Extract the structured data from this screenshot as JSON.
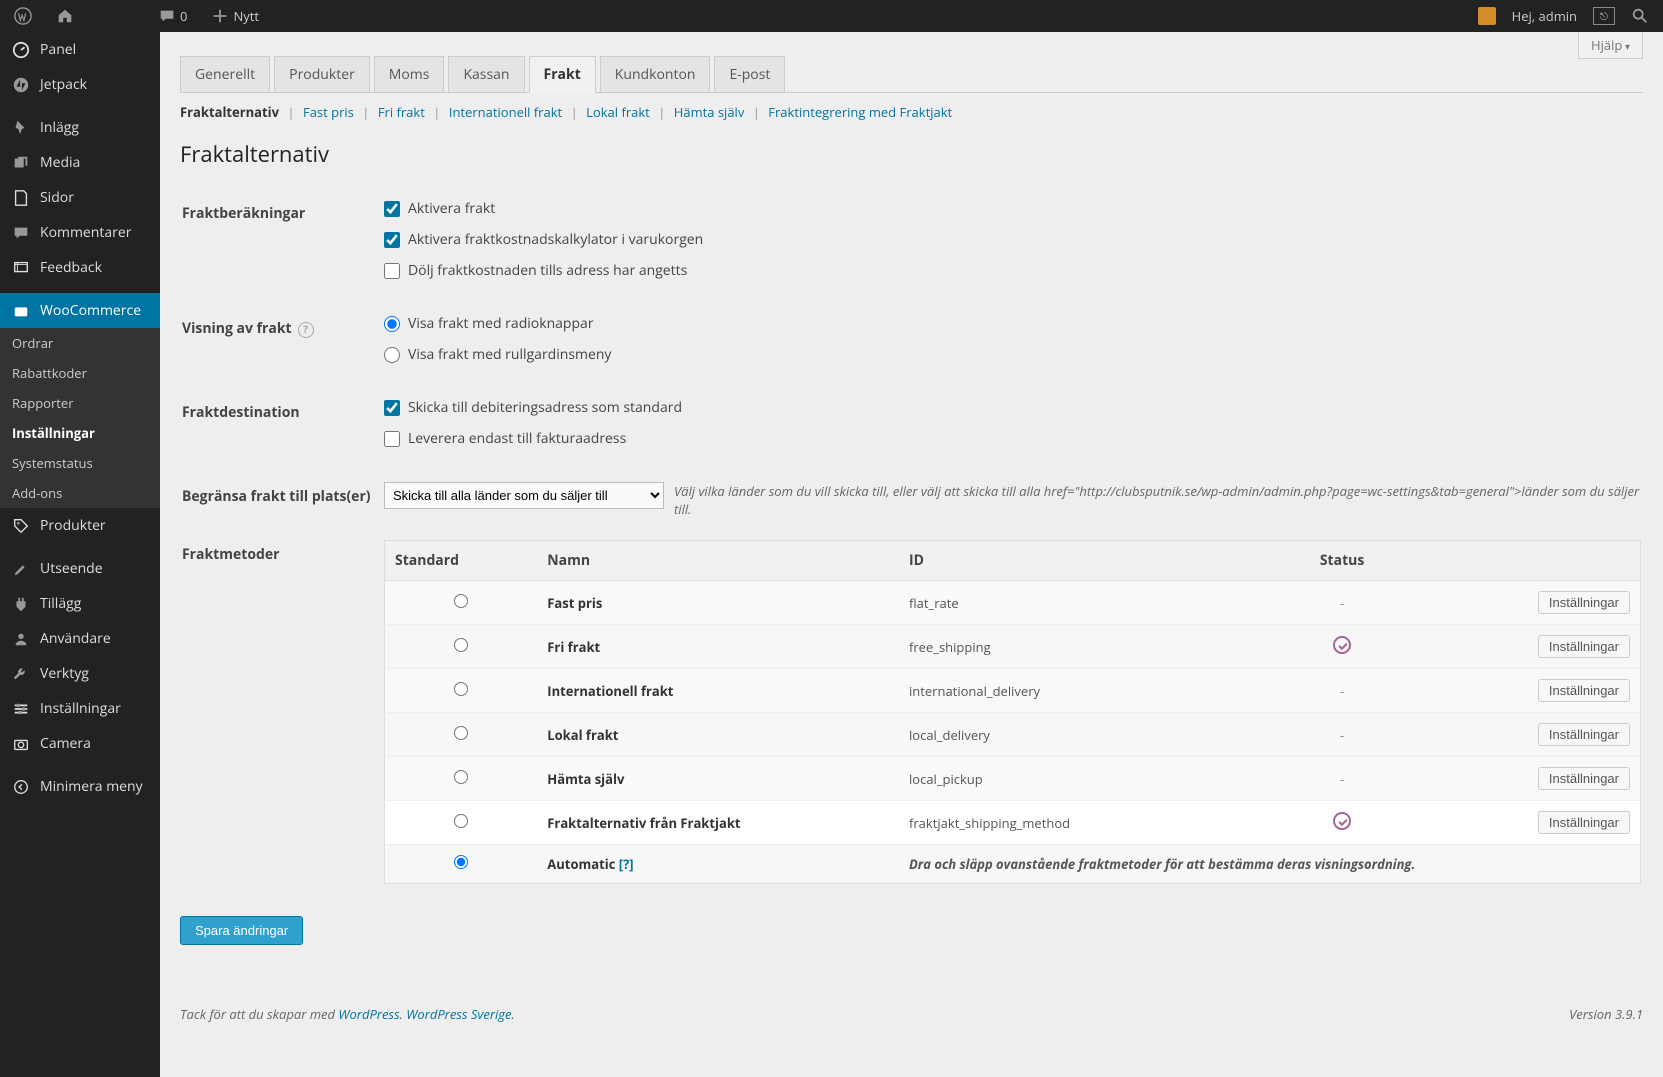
{
  "adminbar": {
    "comments": "0",
    "new_label": "Nytt",
    "greeting": "Hej, admin"
  },
  "sidebar": {
    "items": [
      {
        "label": "Panel",
        "icon": "dashboard"
      },
      {
        "label": "Jetpack",
        "icon": "jetpack"
      },
      {
        "label": "Inlägg",
        "icon": "pin"
      },
      {
        "label": "Media",
        "icon": "media"
      },
      {
        "label": "Sidor",
        "icon": "page"
      },
      {
        "label": "Kommentarer",
        "icon": "comment"
      },
      {
        "label": "Feedback",
        "icon": "feedback"
      },
      {
        "label": "WooCommerce",
        "icon": "cart"
      },
      {
        "label": "Produkter",
        "icon": "tag"
      },
      {
        "label": "Utseende",
        "icon": "brush"
      },
      {
        "label": "Tillägg",
        "icon": "plugin"
      },
      {
        "label": "Användare",
        "icon": "user"
      },
      {
        "label": "Verktyg",
        "icon": "wrench"
      },
      {
        "label": "Inställningar",
        "icon": "sliders"
      },
      {
        "label": "Camera",
        "icon": "camera"
      },
      {
        "label": "Minimera meny",
        "icon": "collapse"
      }
    ],
    "sub_wc": [
      "Ordrar",
      "Rabattkoder",
      "Rapporter",
      "Inställningar",
      "Systemstatus",
      "Add-ons"
    ]
  },
  "help": "Hjälp",
  "tabs": [
    "Generellt",
    "Produkter",
    "Moms",
    "Kassan",
    "Frakt",
    "Kundkonton",
    "E-post"
  ],
  "subtabs": [
    "Fraktalternativ",
    "Fast pris",
    "Fri frakt",
    "Internationell frakt",
    "Lokal frakt",
    "Hämta själv",
    "Fraktintegrering med Fraktjakt"
  ],
  "page_title": "Fraktalternativ",
  "sections": {
    "calc_label": "Fraktberäkningar",
    "enable": "Aktivera frakt",
    "enable_calc": "Aktivera fraktkostnadskalkylator i varukorgen",
    "hide_until": "Dölj fraktkostnaden tills adress har angetts",
    "display_label": "Visning av frakt",
    "radio": "Visa frakt med radioknappar",
    "dropdown": "Visa frakt med rullgardinsmeny",
    "dest_label": "Fraktdestination",
    "ship_billing": "Skicka till debiteringsadress som standard",
    "deliver_only": "Leverera endast till fakturaadress",
    "restrict_label": "Begränsa frakt till plats(er)",
    "restrict_select": "Skicka till alla länder som du säljer till",
    "restrict_desc": "Välj vilka länder som du vill skicka till, eller välj att skicka till alla href=\"http://clubsputnik.se/wp-admin/admin.php?page=wc-settings&tab=general\">länder som du säljer till.",
    "methods_label": "Fraktmetoder"
  },
  "methods_table": {
    "headers": {
      "standard": "Standard",
      "name": "Namn",
      "id": "ID",
      "status": "Status"
    },
    "rows": [
      {
        "name": "Fast pris",
        "id": "flat_rate",
        "status": "-",
        "settings": "Inställningar"
      },
      {
        "name": "Fri frakt",
        "id": "free_shipping",
        "status": "ok",
        "settings": "Inställningar"
      },
      {
        "name": "Internationell frakt",
        "id": "international_delivery",
        "status": "-",
        "settings": "Inställningar"
      },
      {
        "name": "Lokal frakt",
        "id": "local_delivery",
        "status": "-",
        "settings": "Inställningar"
      },
      {
        "name": "Hämta själv",
        "id": "local_pickup",
        "status": "-",
        "settings": "Inställningar"
      },
      {
        "name": "Fraktalternativ från Fraktjakt",
        "id": "fraktjakt_shipping_method",
        "status": "ok",
        "settings": "Inställningar",
        "highlight": true
      }
    ],
    "auto_label": "Automatic",
    "auto_q": "[?]",
    "auto_desc": "Dra och släpp ovanstående fraktmetoder för att bestämma deras visningsordning."
  },
  "save": "Spara ändringar",
  "footer": {
    "thanks": "Tack för att du skapar med ",
    "wp": "WordPress",
    "wpse": "WordPress Sverige",
    "version": "Version 3.9.1"
  }
}
